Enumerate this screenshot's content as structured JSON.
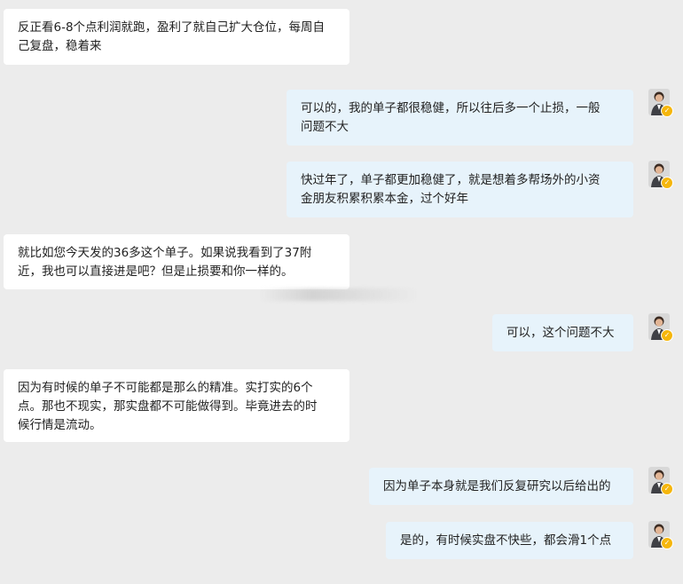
{
  "messages": [
    {
      "side": "left",
      "text": "反正看6-8个点利润就跑，盈利了就自己扩大仓位，每周自\n己复盘，稳着来"
    },
    {
      "side": "right",
      "text": "可以的，我的单子都很稳健，所以往后多一个止损，一般\n问题不大"
    },
    {
      "side": "right",
      "text": "快过年了，单子都更加稳健了，就是想着多帮场外的小资\n金朋友积累积累本金，过个好年"
    },
    {
      "side": "left",
      "text": "就比如您今天发的36多这个单子。如果说我看到了37附\n近，我也可以直接进是吧？但是止损要和你一样的。"
    },
    {
      "side": "right",
      "text": "可以，这个问题不大"
    },
    {
      "side": "left",
      "text": "因为有时候的单子不可能都是那么的精准。实打实的6个\n点。那也不现实，那实盘都不可能做得到。毕竟进去的时\n候行情是流动。"
    },
    {
      "side": "right",
      "text": "因为单子本身就是我们反复研究以后给出的"
    },
    {
      "side": "right",
      "text": "是的，有时候实盘不快些，都会滑1个点"
    }
  ]
}
